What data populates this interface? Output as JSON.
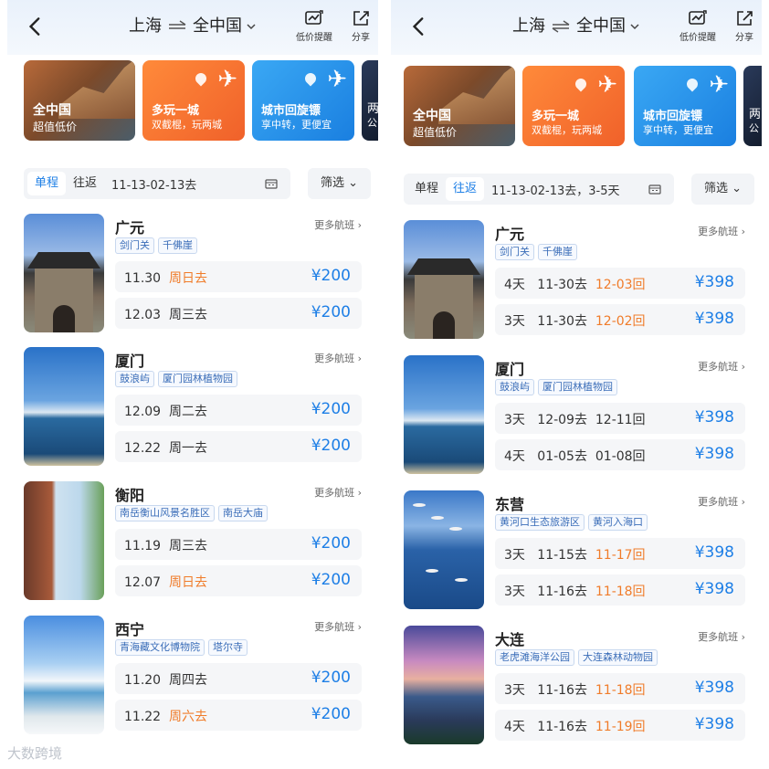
{
  "left": {
    "header": {
      "from": "上海",
      "to": "全中国",
      "alert_label": "低价提醒",
      "share_label": "分享"
    },
    "banners": [
      {
        "title": "全中国",
        "subtitle": "超值低价"
      },
      {
        "title": "多玩一城",
        "subtitle": "双截棍，玩两城"
      },
      {
        "title": "城市回旋镖",
        "subtitle": "享中转，更便宜"
      },
      {
        "title": "两",
        "subtitle": "公"
      }
    ],
    "filter": {
      "oneway": "单程",
      "roundtrip": "往返",
      "date_range": "11-13-02-13去",
      "filter_label": "筛选"
    },
    "destinations": [
      {
        "city": "广元",
        "more": "更多航班",
        "tags": [
          "剑门关",
          "千佛崖"
        ],
        "rows": [
          {
            "date": "11.30",
            "day": "周日去",
            "day_orange": true,
            "price": "¥200"
          },
          {
            "date": "12.03",
            "day": "周三去",
            "day_orange": false,
            "price": "¥200"
          }
        ]
      },
      {
        "city": "厦门",
        "more": "更多航班",
        "tags": [
          "鼓浪屿",
          "厦门园林植物园"
        ],
        "rows": [
          {
            "date": "12.09",
            "day": "周二去",
            "day_orange": false,
            "price": "¥200"
          },
          {
            "date": "12.22",
            "day": "周一去",
            "day_orange": false,
            "price": "¥200"
          }
        ]
      },
      {
        "city": "衡阳",
        "more": "更多航班",
        "tags": [
          "南岳衡山风景名胜区",
          "南岳大庙"
        ],
        "rows": [
          {
            "date": "11.19",
            "day": "周三去",
            "day_orange": false,
            "price": "¥200"
          },
          {
            "date": "12.07",
            "day": "周日去",
            "day_orange": true,
            "price": "¥200"
          }
        ]
      },
      {
        "city": "西宁",
        "more": "更多航班",
        "tags": [
          "青海藏文化博物院",
          "塔尔寺"
        ],
        "rows": [
          {
            "date": "11.20",
            "day": "周四去",
            "day_orange": false,
            "price": "¥200"
          },
          {
            "date": "11.22",
            "day": "周六去",
            "day_orange": true,
            "price": "¥200"
          }
        ]
      }
    ]
  },
  "right": {
    "header": {
      "from": "上海",
      "to": "全中国",
      "alert_label": "低价提醒",
      "share_label": "分享"
    },
    "banners": [
      {
        "title": "全中国",
        "subtitle": "超值低价"
      },
      {
        "title": "多玩一城",
        "subtitle": "双截棍，玩两城"
      },
      {
        "title": "城市回旋镖",
        "subtitle": "享中转，更便宜"
      },
      {
        "title": "两",
        "subtitle": "公"
      }
    ],
    "filter": {
      "oneway": "单程",
      "roundtrip": "往返",
      "date_range": "11-13-02-13去，3-5天",
      "filter_label": "筛选"
    },
    "destinations": [
      {
        "city": "广元",
        "more": "更多航班",
        "tags": [
          "剑门关",
          "千佛崖"
        ],
        "rows": [
          {
            "days": "4天",
            "depart": "11-30去",
            "ret": "12-03回",
            "ret_orange": true,
            "price": "¥398"
          },
          {
            "days": "3天",
            "depart": "11-30去",
            "ret": "12-02回",
            "ret_orange": true,
            "price": "¥398"
          }
        ]
      },
      {
        "city": "厦门",
        "more": "更多航班",
        "tags": [
          "鼓浪屿",
          "厦门园林植物园"
        ],
        "rows": [
          {
            "days": "3天",
            "depart": "12-09去",
            "ret": "12-11回",
            "ret_orange": false,
            "price": "¥398"
          },
          {
            "days": "4天",
            "depart": "01-05去",
            "ret": "01-08回",
            "ret_orange": false,
            "price": "¥398"
          }
        ]
      },
      {
        "city": "东营",
        "more": "更多航班",
        "tags": [
          "黄河口生态旅游区",
          "黄河入海口"
        ],
        "rows": [
          {
            "days": "3天",
            "depart": "11-15去",
            "ret": "11-17回",
            "ret_orange": true,
            "price": "¥398"
          },
          {
            "days": "3天",
            "depart": "11-16去",
            "ret": "11-18回",
            "ret_orange": true,
            "price": "¥398"
          }
        ]
      },
      {
        "city": "大连",
        "more": "更多航班",
        "tags": [
          "老虎滩海洋公园",
          "大连森林动物园"
        ],
        "rows": [
          {
            "days": "3天",
            "depart": "11-16去",
            "ret": "11-18回",
            "ret_orange": true,
            "price": "¥398"
          },
          {
            "days": "4天",
            "depart": "11-16去",
            "ret": "11-19回",
            "ret_orange": true,
            "price": "¥398"
          }
        ]
      }
    ]
  },
  "watermark": "大数跨境",
  "colors": {
    "accent": "#1e7fe6",
    "orange": "#f07c2a",
    "tag_text": "#3a6db8"
  },
  "icons": {
    "back": "chevron-left-icon",
    "alert": "price-alert-icon",
    "share": "share-icon",
    "calendar": "calendar-icon",
    "more": "chevron-right-icon"
  }
}
